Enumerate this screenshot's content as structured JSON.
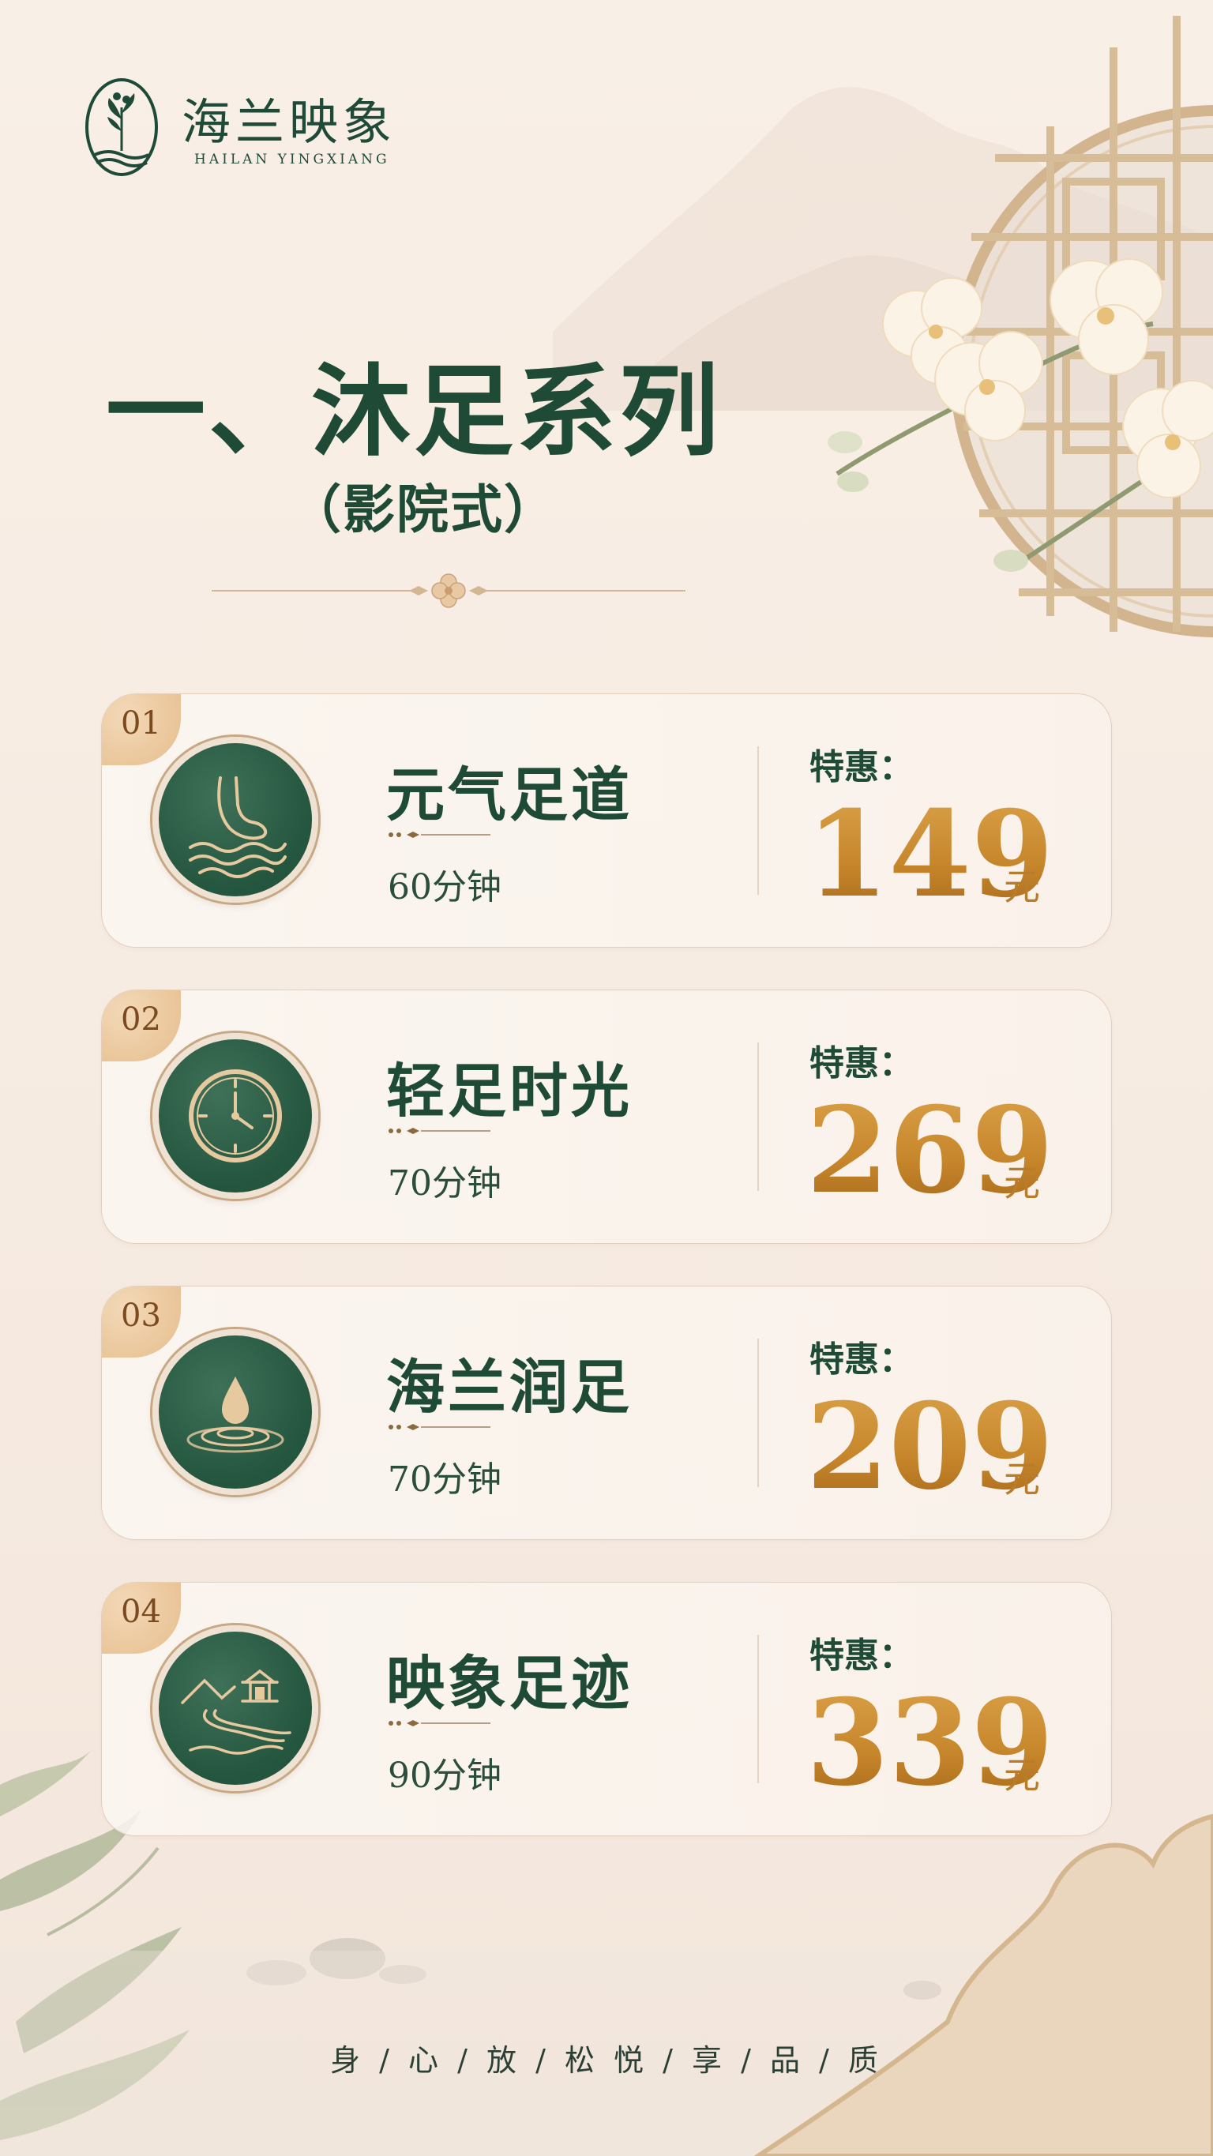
{
  "brand": {
    "name": "海兰映象",
    "subtitle": "HAILAN YINGXIANG"
  },
  "section": {
    "title": "一、沐足系列",
    "subtitle": "（影院式）"
  },
  "services": [
    {
      "number": "01",
      "name": "元气足道",
      "duration": "60分钟",
      "price_label": "特惠：",
      "price": "149",
      "unit": "元",
      "icon": "foot-water-icon"
    },
    {
      "number": "02",
      "name": "轻足时光",
      "duration": "70分钟",
      "price_label": "特惠：",
      "price": "269",
      "unit": "元",
      "icon": "clock-icon"
    },
    {
      "number": "03",
      "name": "海兰润足",
      "duration": "70分钟",
      "price_label": "特惠：",
      "price": "209",
      "unit": "元",
      "icon": "water-drop-icon"
    },
    {
      "number": "04",
      "name": "映象足迹",
      "duration": "90分钟",
      "price_label": "特惠：",
      "price": "339",
      "unit": "元",
      "icon": "pavilion-river-icon"
    }
  ],
  "footer": {
    "slogan": "身 / 心 / 放 / 松    悦 / 享 / 品 / 质"
  },
  "colors": {
    "background": "#f7ede3",
    "primary_green": "#1e4a36",
    "icon_green": "#2a5a43",
    "gold": "#c98a2b",
    "badge": "#e9c394"
  }
}
